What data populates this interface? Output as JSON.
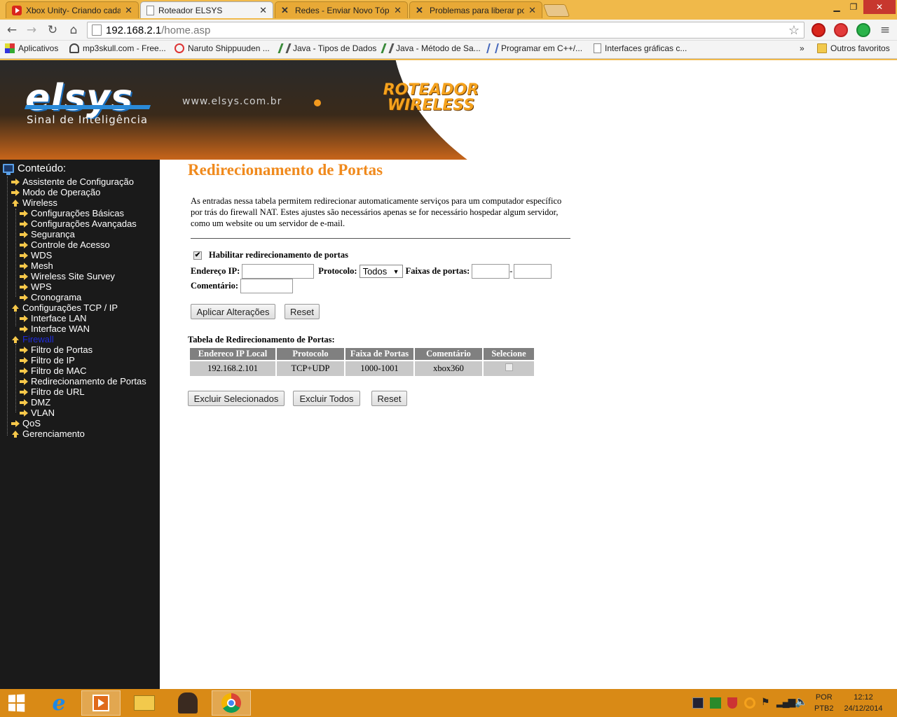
{
  "browser": {
    "tabs": [
      {
        "label": "Xbox Unity- Criando cada",
        "icon": "youtube-icon",
        "active": false
      },
      {
        "label": "Roteador ELSYS",
        "icon": "page-icon",
        "active": true
      },
      {
        "label": "Redes - Enviar Novo Tópic",
        "icon": "x-forum-icon",
        "active": false
      },
      {
        "label": "Problemas para liberar po",
        "icon": "x-forum-icon",
        "active": false
      }
    ],
    "address": {
      "host": "192.168.2.1",
      "path": "/home.asp"
    },
    "bookmarks": [
      {
        "label": "Aplicativos",
        "icon": "apps-grid-icon"
      },
      {
        "label": "mp3skull.com - Free...",
        "icon": "headphones-icon"
      },
      {
        "label": "Naruto Shippuuden ...",
        "icon": "swirl-icon"
      },
      {
        "label": "Java - Tipos de Dados",
        "icon": "dna-icon"
      },
      {
        "label": "Java - Método de Sa...",
        "icon": "dna-icon"
      },
      {
        "label": "Programar em C++/...",
        "icon": "book-icon"
      },
      {
        "label": "Interfaces gráficas c...",
        "icon": "page-icon"
      }
    ],
    "bookmarks_overflow": "»",
    "other_bookmarks": "Outros favoritos",
    "colors": {
      "frame": "#f0b94a",
      "close": "#c7372e"
    }
  },
  "header": {
    "logo": "elsys",
    "tagline": "Sinal de Inteligência",
    "url": "www.elsys.com.br",
    "brand_line1": "ROTEADOR",
    "brand_line2": "WIRELESS"
  },
  "sidebar": {
    "title": "Conteúdo:",
    "items": [
      {
        "label": "Assistente de Configuração",
        "level": 0,
        "icon": "arrow-right-icon"
      },
      {
        "label": "Modo de Operação",
        "level": 0,
        "icon": "arrow-right-icon"
      },
      {
        "label": "Wireless",
        "level": 0,
        "icon": "arrow-up-icon"
      },
      {
        "label": "Configurações Básicas",
        "level": 1,
        "icon": "arrow-right-icon"
      },
      {
        "label": "Configurações Avançadas",
        "level": 1,
        "icon": "arrow-right-icon"
      },
      {
        "label": "Segurança",
        "level": 1,
        "icon": "arrow-right-icon"
      },
      {
        "label": "Controle de Acesso",
        "level": 1,
        "icon": "arrow-right-icon"
      },
      {
        "label": "WDS",
        "level": 1,
        "icon": "arrow-right-icon"
      },
      {
        "label": "Mesh",
        "level": 1,
        "icon": "arrow-right-icon"
      },
      {
        "label": "Wireless Site Survey",
        "level": 1,
        "icon": "arrow-right-icon"
      },
      {
        "label": "WPS",
        "level": 1,
        "icon": "arrow-right-icon"
      },
      {
        "label": "Cronograma",
        "level": 1,
        "icon": "arrow-right-icon"
      },
      {
        "label": "Configurações TCP / IP",
        "level": 0,
        "icon": "arrow-up-icon"
      },
      {
        "label": "Interface LAN",
        "level": 1,
        "icon": "arrow-right-icon"
      },
      {
        "label": "Interface WAN",
        "level": 1,
        "icon": "arrow-right-icon"
      },
      {
        "label": "Firewall",
        "level": 0,
        "icon": "arrow-up-icon",
        "selected": true
      },
      {
        "label": "Filtro de Portas",
        "level": 1,
        "icon": "arrow-right-icon"
      },
      {
        "label": "Filtro de IP",
        "level": 1,
        "icon": "arrow-right-icon"
      },
      {
        "label": "Filtro de MAC",
        "level": 1,
        "icon": "arrow-right-icon"
      },
      {
        "label": "Redirecionamento de Portas",
        "level": 1,
        "icon": "arrow-right-icon"
      },
      {
        "label": "Filtro de URL",
        "level": 1,
        "icon": "arrow-right-icon"
      },
      {
        "label": "DMZ",
        "level": 1,
        "icon": "arrow-right-icon"
      },
      {
        "label": "VLAN",
        "level": 1,
        "icon": "arrow-right-icon"
      },
      {
        "label": "QoS",
        "level": 0,
        "icon": "arrow-right-icon"
      },
      {
        "label": "Gerenciamento",
        "level": 0,
        "icon": "arrow-up-icon"
      }
    ]
  },
  "main": {
    "title": "Redirecionamento de Portas",
    "description": "As entradas nessa tabela permitem redirecionar automaticamente serviços para um computador específico por trás do firewall NAT. Estes ajustes são necessários apenas se for necessário hospedar algum servidor, como um website ou um servidor de e-mail.",
    "enable_label": "Habilitar redirecionamento de portas",
    "enable_checked": true,
    "ip_label": "Endereço IP:",
    "ip_value": "",
    "protocol_label": "Protocolo:",
    "protocol_value": "Todos",
    "ports_label": "Faixas de portas:",
    "port_from": "",
    "port_sep": "-",
    "port_to": "",
    "comment_label": "Comentário:",
    "comment_value": "",
    "apply_label": "Aplicar Alterações",
    "reset_label": "Reset",
    "table_caption": "Tabela de Redirecionamento de Portas:",
    "table_headers": [
      "Endereco IP Local",
      "Protocolo",
      "Faixa de Portas",
      "Comentário",
      "Selecione"
    ],
    "table_rows": [
      {
        "ip": "192.168.2.101",
        "protocol": "TCP+UDP",
        "ports": "1000-1001",
        "comment": "xbox360",
        "selected": false
      }
    ],
    "delete_selected_label": "Excluir Selecionados",
    "delete_all_label": "Excluir Todos",
    "reset2_label": "Reset",
    "colors": {
      "title": "#f08a1d",
      "sidebar": "#1a1a1a",
      "header_cell": "#808080",
      "data_cell": "#c8c8c8"
    }
  },
  "taskbar": {
    "lang_top": "POR",
    "lang_bottom": "PTB2",
    "time": "12:12",
    "date": "24/12/2014",
    "color": "#d98a16"
  }
}
